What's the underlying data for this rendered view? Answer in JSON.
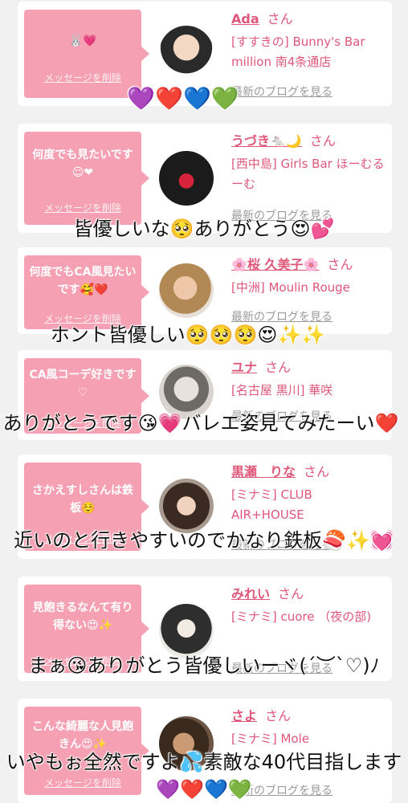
{
  "delete_label": "メッセージを削除",
  "blog_label": "最新のブログを見る",
  "san_label": "さん",
  "cards": [
    {
      "message": "🐰💗",
      "name": "Ada",
      "shop": "[すすきの] Bunny's Bar million 南4条通店"
    },
    {
      "message": "何度でも見たいです☺❤",
      "name": "うづき🐁🌙",
      "shop": "[西中島] Girls Bar ほーむるーむ"
    },
    {
      "message": "何度でもCA風見たいです🥰❤️",
      "name": "🌸桜 久美子🌸",
      "shop": "[中洲] Moulin Rouge"
    },
    {
      "message": "CA風コーデ好きです♡",
      "name": "ユナ",
      "shop": "[名古屋 黒川] 華咲"
    },
    {
      "message": "さかえすしさんは鉄板☺️",
      "name": "黒瀬　りな",
      "shop": "[ミナミ] CLUB AIR+HOUSE"
    },
    {
      "message": "見飽きるなんて有り得ない😍✨",
      "name": "みれい",
      "shop": "[ミナミ] cuore （夜の部)"
    },
    {
      "message": "こんな綺麗な人見飽きん😍✨",
      "name": "さよ",
      "shop": "[ミナミ] Mole"
    }
  ],
  "overlay": {
    "hearts": "💜❤️💙💚",
    "caption_1": "皆優しいな🥺ありがとう😍💕",
    "caption_2": "ホント皆優しい🥺🥺🥺😍✨✨",
    "caption_3": "ありがとうです😘💗バレエ姿見てみたーい❤️",
    "caption_4": "近いのと行きやすいのでかなり鉄板🍣✨💓",
    "caption_5": "まぁ😘ありがとう皆優しいーヾ(´︶`♡)ﾉ",
    "caption_6": "いやもぉ全然ですよ💦素敵な40代目指します💜❤️💙💚"
  }
}
